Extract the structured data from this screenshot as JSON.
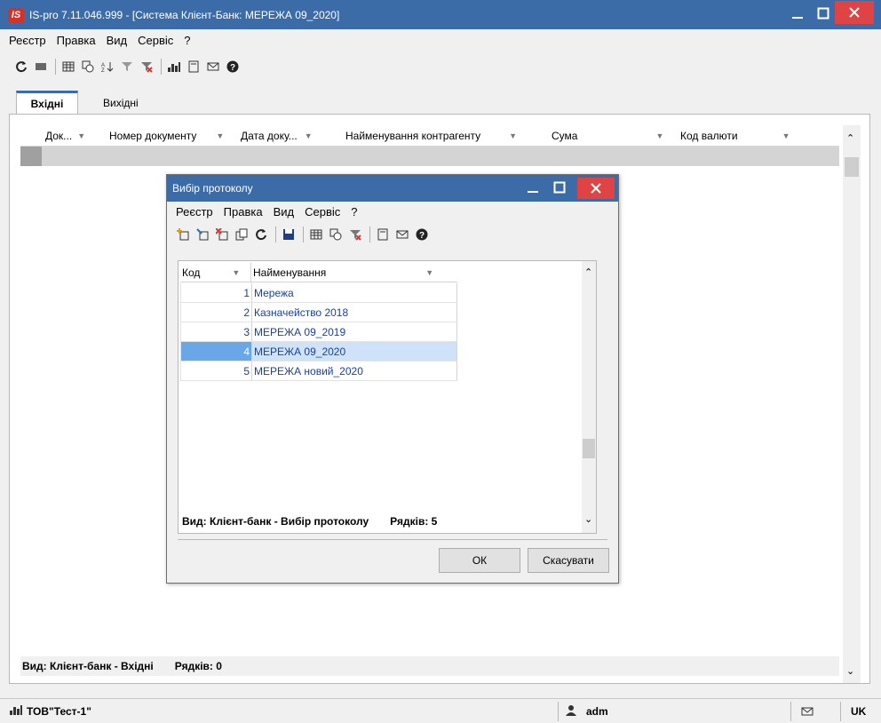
{
  "window": {
    "logo": "IS",
    "title": "IS-pro 7.11.046.999 - [Система Клієнт-Банк: МЕРЕЖА 09_2020]"
  },
  "menu": [
    "Реєстр",
    "Правка",
    "Вид",
    "Сервіс",
    "?"
  ],
  "tabs": {
    "active": "Вхідні",
    "other": "Вихідні"
  },
  "grid": {
    "columns": [
      "Док...",
      "Номер документу",
      "Дата доку...",
      "Найменування контрагенту",
      "Сума",
      "Код валюти"
    ],
    "footer_view": "Вид: Клієнт-банк - Вхідні",
    "footer_rows": "Рядків: 0"
  },
  "dialog": {
    "title": "Вибір протоколу",
    "menu": [
      "Реєстр",
      "Правка",
      "Вид",
      "Сервіс",
      "?"
    ],
    "columns": [
      "Код",
      "Найменування"
    ],
    "rows": [
      {
        "code": "1",
        "name": "Мережа"
      },
      {
        "code": "2",
        "name": "Казначейство 2018"
      },
      {
        "code": "3",
        "name": "МЕРЕЖА 09_2019"
      },
      {
        "code": "4",
        "name": "МЕРЕЖА 09_2020"
      },
      {
        "code": "5",
        "name": "МЕРЕЖА новий_2020"
      }
    ],
    "selected_code": "4",
    "footer_view": "Вид: Клієнт-банк - Вибір протоколу",
    "footer_rows": "Рядків: 5",
    "ok_label": "ОК",
    "cancel_label": "Скасувати"
  },
  "status": {
    "company": "ТОВ\"Тест-1\"",
    "user": "adm",
    "lang": "UK"
  },
  "colors": {
    "titlebar": "#3c6ca8",
    "close": "#e04343",
    "selection": "#6aa7e6"
  }
}
